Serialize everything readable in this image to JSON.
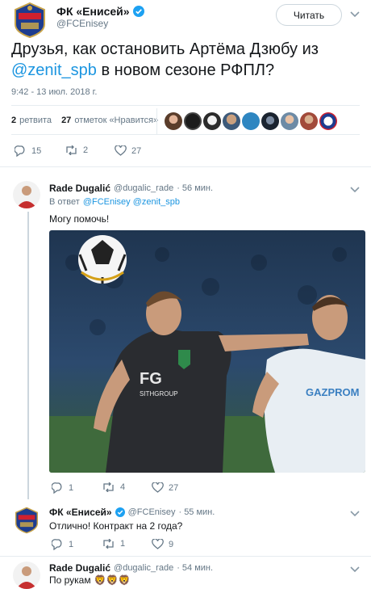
{
  "main_tweet": {
    "author_name": "ФК «Енисей»",
    "handle": "@FCEnisey",
    "follow_label": "Читать",
    "text_part1": "Друзья, как остановить Артёма Дзюбу из",
    "text_mention": "@zenit_spb",
    "text_part2": "в новом сезоне РФПЛ?",
    "timestamp": "9:42 - 13 июл. 2018 г.",
    "retweets_count": "2",
    "retweets_label": "ретвита",
    "likes_count": "27",
    "likes_label": "отметок «Нравится»",
    "actions": {
      "replies": "15",
      "retweets": "2",
      "likes": "27"
    }
  },
  "replies": [
    {
      "name": "Rade Dugalić",
      "handle": "@dugalic_rade",
      "time": "· 56 мин.",
      "in_reply_prefix": "В ответ",
      "in_reply_handles": "@FCEnisey @zenit_spb",
      "text": "Могу помочь!",
      "actions": {
        "replies": "1",
        "retweets": "4",
        "likes": "27"
      }
    },
    {
      "name": "ФК «Енисей»",
      "handle": "@FCEnisey",
      "time": "· 55 мин.",
      "text": "Отлично! Контракт на 2 года?",
      "actions": {
        "replies": "1",
        "retweets": "1",
        "likes": "9"
      }
    },
    {
      "name": "Rade Dugalić",
      "handle": "@dugalic_rade",
      "time": "· 54 мин.",
      "text": "По рукам",
      "emoji": "🦁🦁🦁"
    }
  ],
  "photo": {
    "shirt_text_main": "FG",
    "shirt_text_sub": "SITHGROUP",
    "ball_label": "BALL",
    "opponent_shirt_text": "GAZPROM"
  },
  "colors": {
    "link": "#1b95e0",
    "muted": "#657786",
    "verified": "#1da1f2",
    "separator": "#e6ecf0"
  }
}
